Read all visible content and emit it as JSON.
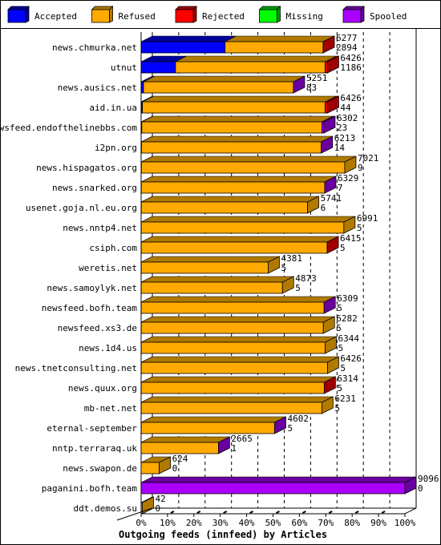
{
  "chart_data": {
    "type": "bar",
    "orientation": "horizontal",
    "stacked": true,
    "style": "3d",
    "title": "Outgoing feeds (innfeed) by Articles",
    "xlabel": "Outgoing feeds (innfeed) by Articles",
    "ylabel": "",
    "x_unit": "percent of max total",
    "xlim": [
      0,
      100
    ],
    "x_ticks": [
      "0%",
      "10%",
      "20%",
      "30%",
      "40%",
      "50%",
      "60%",
      "70%",
      "80%",
      "90%",
      "100%"
    ],
    "grid": true,
    "legend_position": "top",
    "max_total": 9096,
    "legend": [
      {
        "name": "Accepted",
        "color": "#0000ff",
        "side": "#00009a"
      },
      {
        "name": "Refused",
        "color": "#ffaa00",
        "side": "#b07a00"
      },
      {
        "name": "Rejected",
        "color": "#ff0000",
        "side": "#a00000"
      },
      {
        "name": "Missing",
        "color": "#00ff00",
        "side": "#00a000"
      },
      {
        "name": "Spooled",
        "color": "#aa00ff",
        "side": "#6a00a0"
      }
    ],
    "categories": [
      "news.chmurka.net",
      "utnut",
      "news.ausics.net",
      "aid.in.ua",
      "newsfeed.endofthelinebbs.com",
      "i2pn.org",
      "news.hispagatos.org",
      "news.snarked.org",
      "usenet.goja.nl.eu.org",
      "news.nntp4.net",
      "csiph.com",
      "weretis.net",
      "news.samoylyk.net",
      "newsfeed.bofh.team",
      "newsfeed.xs3.de",
      "news.1d4.us",
      "news.tnetconsulting.net",
      "news.quux.org",
      "mb-net.net",
      "eternal-september",
      "nntp.terraraq.uk",
      "news.swapon.de",
      "paganini.bofh.team",
      "ddt.demos.su"
    ],
    "totals": [
      6277,
      6426,
      5251,
      6426,
      6302,
      6213,
      7021,
      6329,
      5741,
      6991,
      6415,
      4381,
      4873,
      6309,
      6282,
      6344,
      6426,
      6314,
      6231,
      4602,
      2665,
      624,
      9096,
      42
    ],
    "accepted_labels": [
      2894,
      1186,
      83,
      44,
      23,
      14,
      9,
      7,
      6,
      5,
      5,
      5,
      5,
      5,
      5,
      5,
      5,
      5,
      5,
      5,
      1,
      0,
      0,
      0
    ],
    "series": [
      {
        "name": "Accepted",
        "values": [
          2894,
          1186,
          83,
          44,
          23,
          14,
          9,
          7,
          6,
          5,
          5,
          5,
          5,
          5,
          5,
          5,
          5,
          5,
          5,
          5,
          1,
          0,
          0,
          0
        ]
      },
      {
        "name": "Refused",
        "values": [
          3380,
          5160,
          5168,
          6302,
          6209,
          6199,
          7012,
          6322,
          5735,
          6986,
          6410,
          4376,
          4868,
          6304,
          6277,
          6339,
          6421,
          6309,
          6226,
          4597,
          2664,
          624,
          0,
          42
        ]
      },
      {
        "name": "Rejected",
        "values": [
          3,
          80,
          0,
          80,
          0,
          0,
          0,
          0,
          0,
          0,
          0,
          0,
          0,
          0,
          0,
          0,
          0,
          0,
          0,
          0,
          0,
          0,
          0,
          0
        ]
      },
      {
        "name": "Missing",
        "values": [
          0,
          0,
          0,
          0,
          0,
          0,
          0,
          0,
          0,
          0,
          0,
          0,
          0,
          0,
          0,
          0,
          0,
          0,
          0,
          0,
          0,
          0,
          0,
          0
        ]
      },
      {
        "name": "Spooled",
        "values": [
          0,
          0,
          0,
          0,
          70,
          0,
          0,
          0,
          0,
          0,
          0,
          0,
          0,
          0,
          0,
          0,
          0,
          0,
          0,
          0,
          0,
          0,
          9096,
          0
        ]
      }
    ],
    "end_colors": [
      "Rejected",
      "Rejected",
      "Spooled",
      "Rejected",
      "Spooled",
      "Spooled",
      "Refused",
      "Spooled",
      "Refused",
      "Refused",
      "Rejected",
      "Refused",
      "Refused",
      "Spooled",
      "Refused",
      "Refused",
      "Refused",
      "Rejected",
      "Refused",
      "Spooled",
      "Spooled",
      "Refused",
      "Spooled",
      "Refused"
    ]
  }
}
